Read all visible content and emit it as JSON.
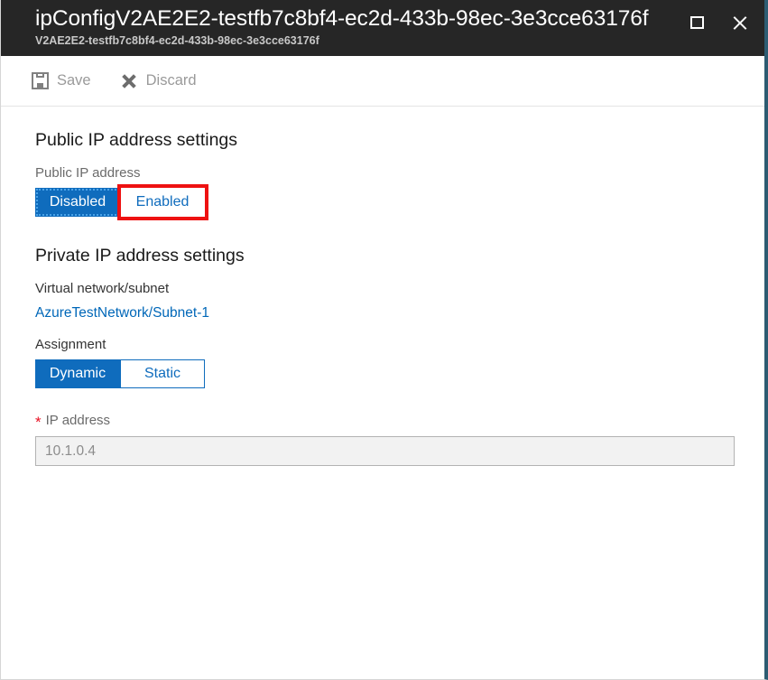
{
  "window": {
    "title": "ipConfigV2AE2E2-testfb7c8bf4-ec2d-433b-98ec-3e3cce63176f",
    "subtitle": "V2AE2E2-testfb7c8bf4-ec2d-433b-98ec-3e3cce63176f",
    "maximize_icon": "maximize-icon",
    "close_icon": "close-icon"
  },
  "toolbar": {
    "save_label": "Save",
    "save_icon": "save-icon",
    "discard_label": "Discard",
    "discard_icon": "discard-icon"
  },
  "public_ip_section": {
    "heading": "Public IP address settings",
    "field_label": "Public IP address",
    "options": [
      {
        "label": "Disabled",
        "selected": true
      },
      {
        "label": "Enabled",
        "selected": false
      }
    ],
    "highlighted_option": "Enabled"
  },
  "private_ip_section": {
    "heading": "Private IP address settings",
    "vnet_label": "Virtual network/subnet",
    "vnet_value": "AzureTestNetwork/Subnet-1",
    "assignment_label": "Assignment",
    "assignment_options": [
      {
        "label": "Dynamic",
        "selected": true
      },
      {
        "label": "Static",
        "selected": false
      }
    ],
    "ip_label": "IP address",
    "ip_required_marker": "*",
    "ip_value": "10.1.0.4",
    "ip_placeholder": "10.1.0.4"
  },
  "colors": {
    "header_background": "#262626",
    "accent_blue": "#0f6cbd",
    "link_blue": "#0067b8",
    "annotation_red": "#ee1111",
    "required_red": "#e81123",
    "blade_edge": "#2d5c72"
  }
}
